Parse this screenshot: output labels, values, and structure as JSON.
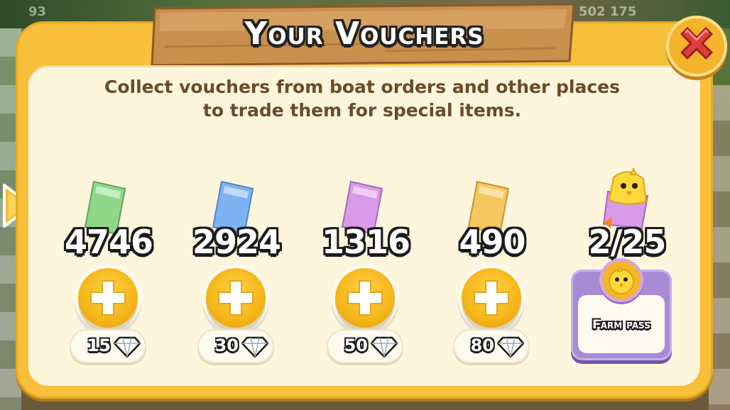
{
  "dialog": {
    "title": "Your Vouchers",
    "description_line1": "Collect vouchers from boat orders and other places",
    "description_line2": "to trade them for special items."
  },
  "background": {
    "left_counter": "93",
    "right_counter": "502 175"
  },
  "vouchers": [
    {
      "color": "green",
      "ticket_color": "#8fd88a",
      "count": "4746",
      "price": "15"
    },
    {
      "color": "blue",
      "ticket_color": "#7db3f2",
      "count": "2924",
      "price": "30"
    },
    {
      "color": "purple",
      "ticket_color": "#d99ae8",
      "count": "1316",
      "price": "50"
    },
    {
      "color": "gold",
      "ticket_color": "#f5c75e",
      "count": "490",
      "price": "80"
    }
  ],
  "farm_pass": {
    "progress_text": "2/25",
    "progress_value": 2,
    "progress_max": 25,
    "label": "Farm pass"
  },
  "icons": {
    "close": "close-x-icon",
    "plus": "plus-icon",
    "diamond": "diamond-icon",
    "chick": "chick-icon",
    "arrow": "arrow-right-icon"
  },
  "colors": {
    "panel": "#f7bf3a",
    "panel_inner": "#fdf6dc",
    "close_x": "#e23b3b",
    "farm_pass": "#a88bd4",
    "text_brown": "#6b4a2c"
  }
}
